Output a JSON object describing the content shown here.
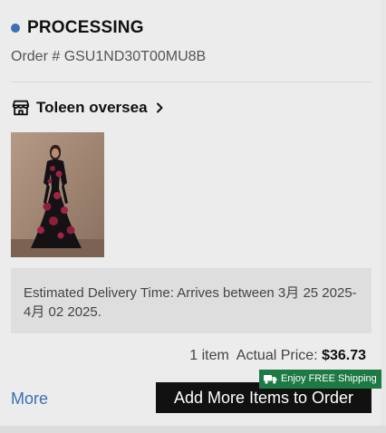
{
  "order": {
    "status": "PROCESSING",
    "status_color": "#3b6fb6",
    "order_number": "Order # GSU1ND30T00MU8B"
  },
  "store": {
    "icon": "store-icon",
    "name": "Toleen oversea",
    "chevron": "chevron-right-icon"
  },
  "product": {
    "image": "product-thumbnail"
  },
  "delivery": {
    "text": "Estimated Delivery Time: Arrives between 3月 25 2025-4月 02 2025."
  },
  "summary": {
    "item_count": "1 item",
    "price_label": "Actual Price:",
    "price_value": "$36.73"
  },
  "actions": {
    "more_label": "More",
    "more_color": "#3b6fb6",
    "add_more_label": "Add More Items to Order",
    "free_shipping_badge": "Enjoy FREE Shipping",
    "free_shipping_icon": "truck-icon",
    "badge_color": "#1e7a44"
  }
}
